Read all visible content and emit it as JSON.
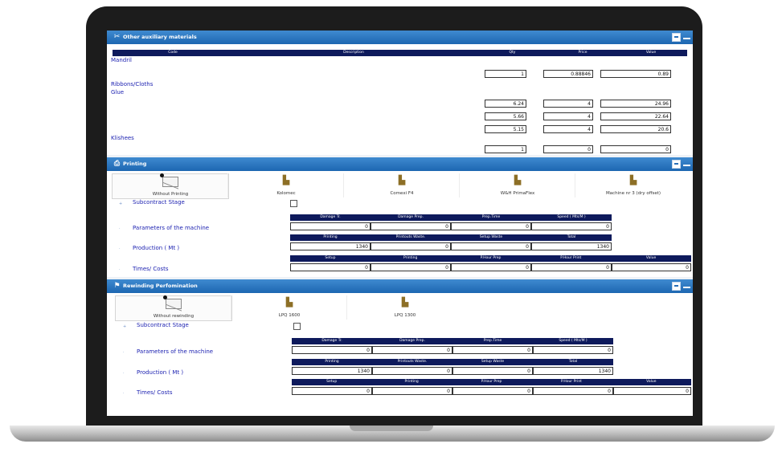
{
  "aux": {
    "title": "Other auxiliary materials",
    "columns": [
      "Code",
      "Description",
      "Qty",
      "Price",
      "Value"
    ],
    "groups": [
      "Mandril",
      "Ribbons/Cloths",
      "Glue",
      "Klishees"
    ],
    "rows": [
      {
        "qty": "1",
        "price": "0.88846",
        "value": "0.89"
      },
      {
        "qty": "6.24",
        "price": "4",
        "value": "24.96"
      },
      {
        "qty": "5.66",
        "price": "4",
        "value": "22.64"
      },
      {
        "qty": "5.15",
        "price": "4",
        "value": "20.6"
      },
      {
        "qty": "1",
        "price": "0",
        "value": "0"
      }
    ]
  },
  "printing": {
    "title": "Printing",
    "machines": [
      "Without Printing",
      "Kolomec",
      "Comexi F4",
      "W&H PrimaFlex",
      "Machine nr 3 (dry offset)"
    ],
    "subcontract_label": "Subcontract Stage",
    "params_label": "Parameters of the machine",
    "production_label": "Production ( Mt )",
    "times_label": "Times/ Costs",
    "params_headers": [
      "Damage Tr.",
      "Damage Prep.",
      "Prep.Time",
      "Speed ( Mts/M )"
    ],
    "params_values": [
      "0",
      "0",
      "0",
      "0"
    ],
    "production_headers": [
      "Printing",
      "Printouts Waste.",
      "Setup Waste",
      "Total"
    ],
    "production_values": [
      "1340",
      "0",
      "0",
      "1340"
    ],
    "times_headers": [
      "Setup",
      "Printing",
      "P.Hour Prep",
      "P.Hour Print",
      "Value"
    ],
    "times_values": [
      "0",
      "0",
      "0",
      "0",
      "0"
    ]
  },
  "rewinding": {
    "title": "Rewinding Perfomination",
    "machines": [
      "Without rewinding",
      "LPQ 1600",
      "LPQ 1300"
    ],
    "subcontract_label": "Subcontract Stage",
    "params_label": "Parameters of the machine",
    "production_label": "Production ( Mt )",
    "times_label": "Times/ Costs",
    "params_headers": [
      "Damage Tr.",
      "Damage Prep.",
      "Prep.Time",
      "Speed ( Mts/M )"
    ],
    "params_values": [
      "0",
      "0",
      "0",
      "0"
    ],
    "production_headers": [
      "Printing",
      "Printouts Waste.",
      "Setup Waste",
      "Total"
    ],
    "production_values": [
      "1340",
      "0",
      "0",
      "1340"
    ],
    "times_headers": [
      "Setup",
      "Printing",
      "P.Hour Prep",
      "P.Hour Print",
      "Value"
    ],
    "times_values": [
      "0",
      "0",
      "0",
      "0",
      "0"
    ]
  }
}
